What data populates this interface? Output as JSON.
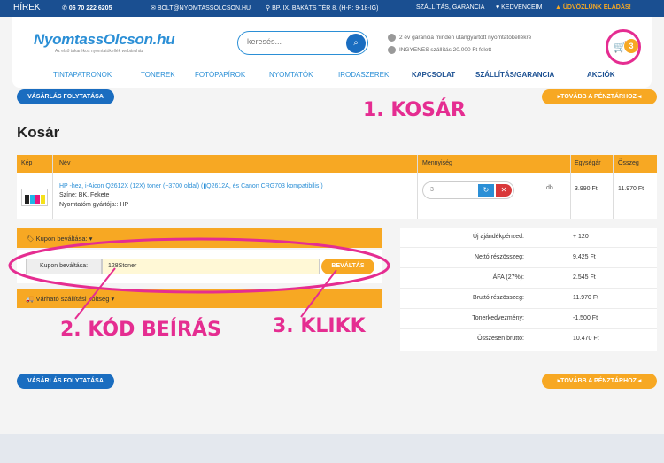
{
  "topbar": {
    "news": "HÍREK",
    "phone": "06 70 222 6205",
    "email": "BOLT@NYOMTASSOLCSON.HU",
    "address": "BP. IX. BAKÁTS TÉR 8. (H-P: 9-18-IG)",
    "shipping": "SZÁLLÍTÁS, GARANCIA",
    "favorites": "KEDVENCEIM",
    "sale": "ÜDVÖZLÜNK ELADÁS!"
  },
  "header": {
    "logo": "NyomtassOlcson.hu",
    "logo_sub": "Az első takarékos nyomtatókellék webáruház",
    "search_placeholder": "keresés...",
    "info1": "2 év garancia minden utángyártott nyomtatókellékre",
    "info2": "INGYENES szállítás 20.000 Ft felett",
    "cart_count": "3"
  },
  "nav": {
    "items": [
      "TINTAPATRONOK",
      "TONEREK",
      "FOTÓPAPÍROK",
      "NYOMTATÓK",
      "IRODASZEREK",
      "KAPCSOLAT",
      "SZÁLLÍTÁS/GARANCIA",
      "AKCIÓK"
    ]
  },
  "actions": {
    "continue": "VÁSÁRLÁS FOLYTATÁSA",
    "checkout": "▸TOVÁBB A PÉNZTÁRHOZ ◂"
  },
  "page": {
    "title": "Kosár"
  },
  "table": {
    "headers": {
      "img": "Kép",
      "name": "Név",
      "qty": "Mennyiség",
      "unit_price": "Egységár",
      "total": "Összeg"
    },
    "item": {
      "name": "HP -hez, i-Aicon Q2612X (12X) toner (~3700 oldal) (▮Q2612A, és Canon CRG703 kompatibilis!)",
      "color": "Színe: BK, Fekete",
      "maker": "Nyomtatóm gyártója:: HP",
      "qty": "3",
      "qty_unit": "db",
      "unit_price": "3.990 Ft",
      "total": "11.970 Ft"
    }
  },
  "coupon": {
    "toggle": "Kupon beváltása:",
    "label": "Kupon beváltása:",
    "value": "128Stoner",
    "button": "BEVÁLTÁS"
  },
  "shipping_toggle": "Várható szállítási költség",
  "summary": [
    {
      "label": "Új ajándékpénzed:",
      "value": "+ 120"
    },
    {
      "label": "Nettó részösszeg:",
      "value": "9.425 Ft"
    },
    {
      "label": "ÁFA (27%):",
      "value": "2.545 Ft"
    },
    {
      "label": "Bruttó részösszeg:",
      "value": "11.970 Ft"
    },
    {
      "label": "Tonerkedvezmény:",
      "value": "-1.500 Ft"
    },
    {
      "label": "Összesen bruttó:",
      "value": "10.470 Ft"
    }
  ],
  "annotations": {
    "a1": "1. KOSÁR",
    "a2": "2. KÓD BEÍRÁS",
    "a3": "3. KLIKK"
  },
  "colors": {
    "blue": "#1a4f91",
    "accent": "#2b8fd6",
    "orange": "#f7a823",
    "pink": "#e52d91"
  }
}
